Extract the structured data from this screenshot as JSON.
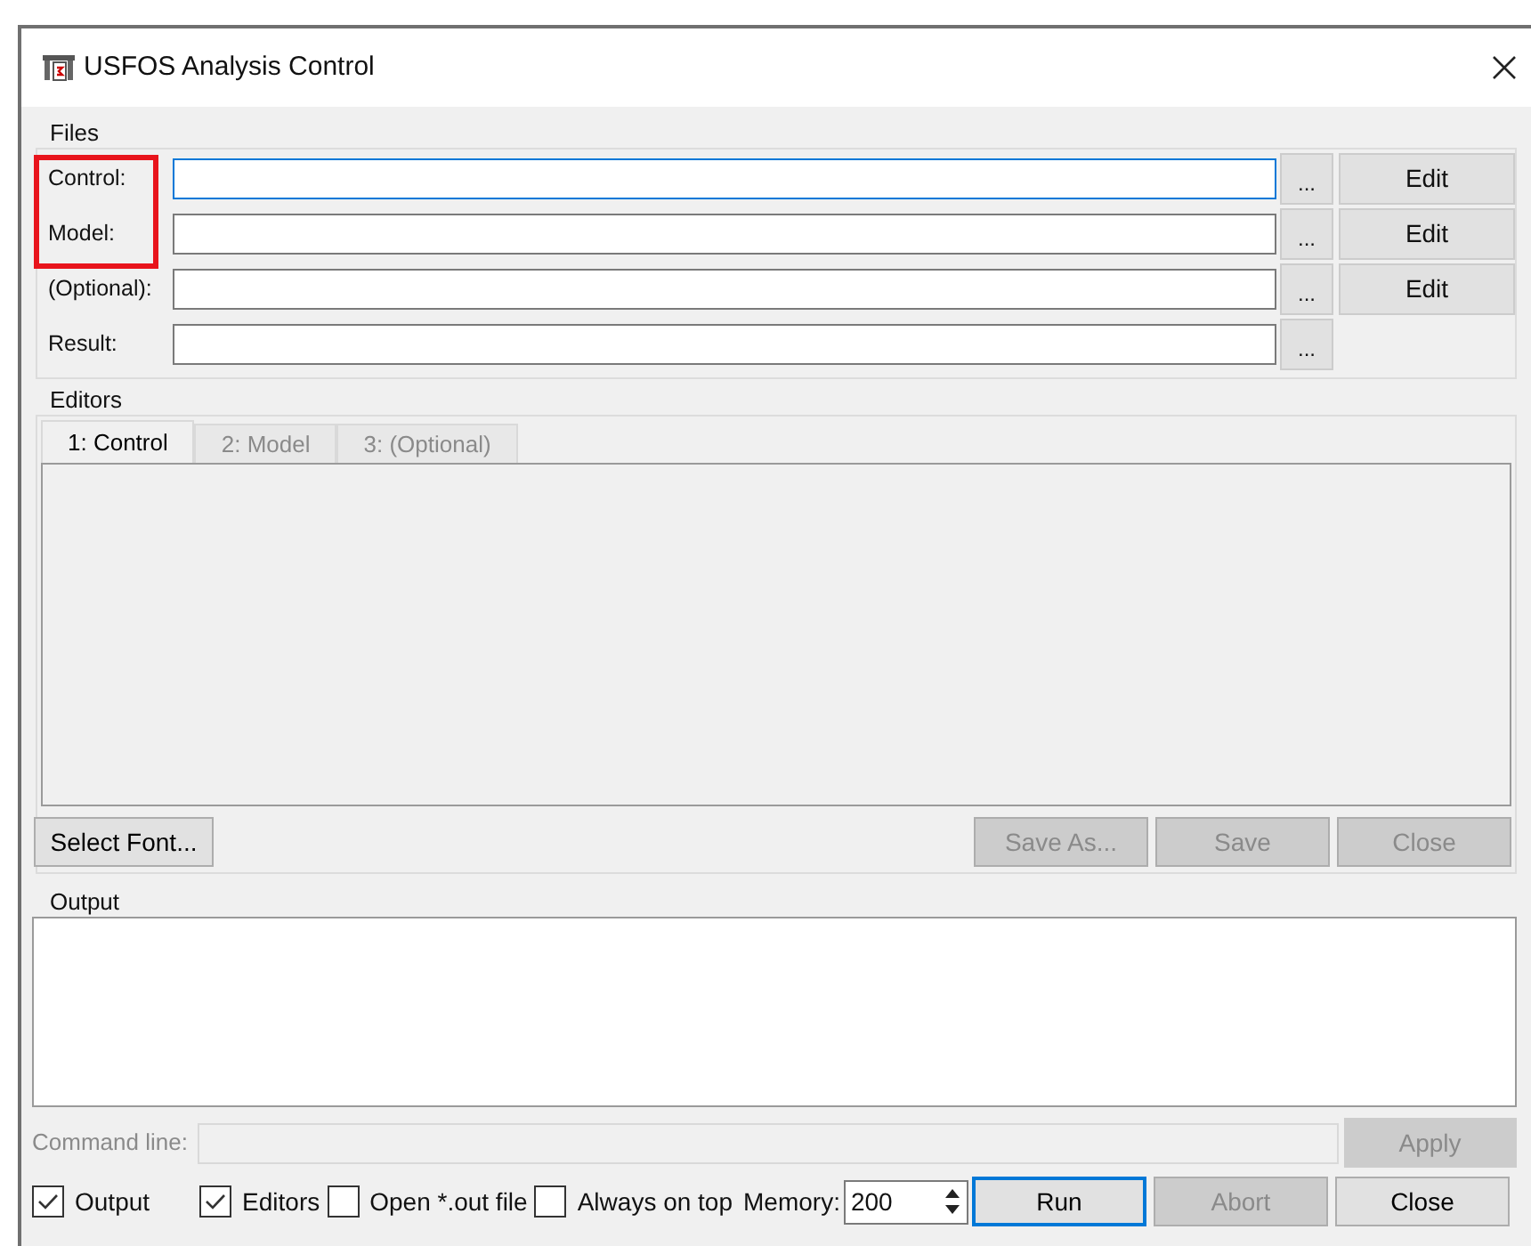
{
  "window": {
    "title": "USFOS Analysis Control"
  },
  "files": {
    "label": "Files",
    "rows": [
      {
        "label": "Control:",
        "focused": true,
        "browse": "...",
        "edit": "Edit"
      },
      {
        "label": "Model:",
        "focused": false,
        "browse": "...",
        "edit": "Edit"
      },
      {
        "label": "(Optional):",
        "focused": false,
        "browse": "...",
        "edit": "Edit"
      },
      {
        "label": "Result:",
        "focused": false,
        "browse": "..."
      }
    ]
  },
  "editors": {
    "label": "Editors",
    "tabs": [
      {
        "label": "1: Control",
        "selected": true
      },
      {
        "label": "2: Model",
        "selected": false
      },
      {
        "label": "3: (Optional)",
        "selected": false
      }
    ],
    "buttons": [
      {
        "label": "Select Font...",
        "disabled": false
      },
      {
        "label": "Save As...",
        "disabled": true
      },
      {
        "label": "Save",
        "disabled": true
      },
      {
        "label": "Close",
        "disabled": true
      }
    ]
  },
  "output": {
    "label": "Output"
  },
  "command_line": {
    "label": "Command line:",
    "disabled": true,
    "apply": "Apply"
  },
  "options": [
    {
      "label": "Output",
      "checked": true
    },
    {
      "label": "Editors",
      "checked": true
    },
    {
      "label": "Open *.out file",
      "checked": false
    },
    {
      "label": "Always on top",
      "checked": false
    }
  ],
  "memory": {
    "label": "Memory:",
    "value": "200"
  },
  "actions": [
    {
      "label": "Run",
      "disabled": false,
      "focused": true
    },
    {
      "label": "Abort",
      "disabled": true,
      "focused": false
    },
    {
      "label": "Close",
      "disabled": false,
      "focused": false
    }
  ]
}
